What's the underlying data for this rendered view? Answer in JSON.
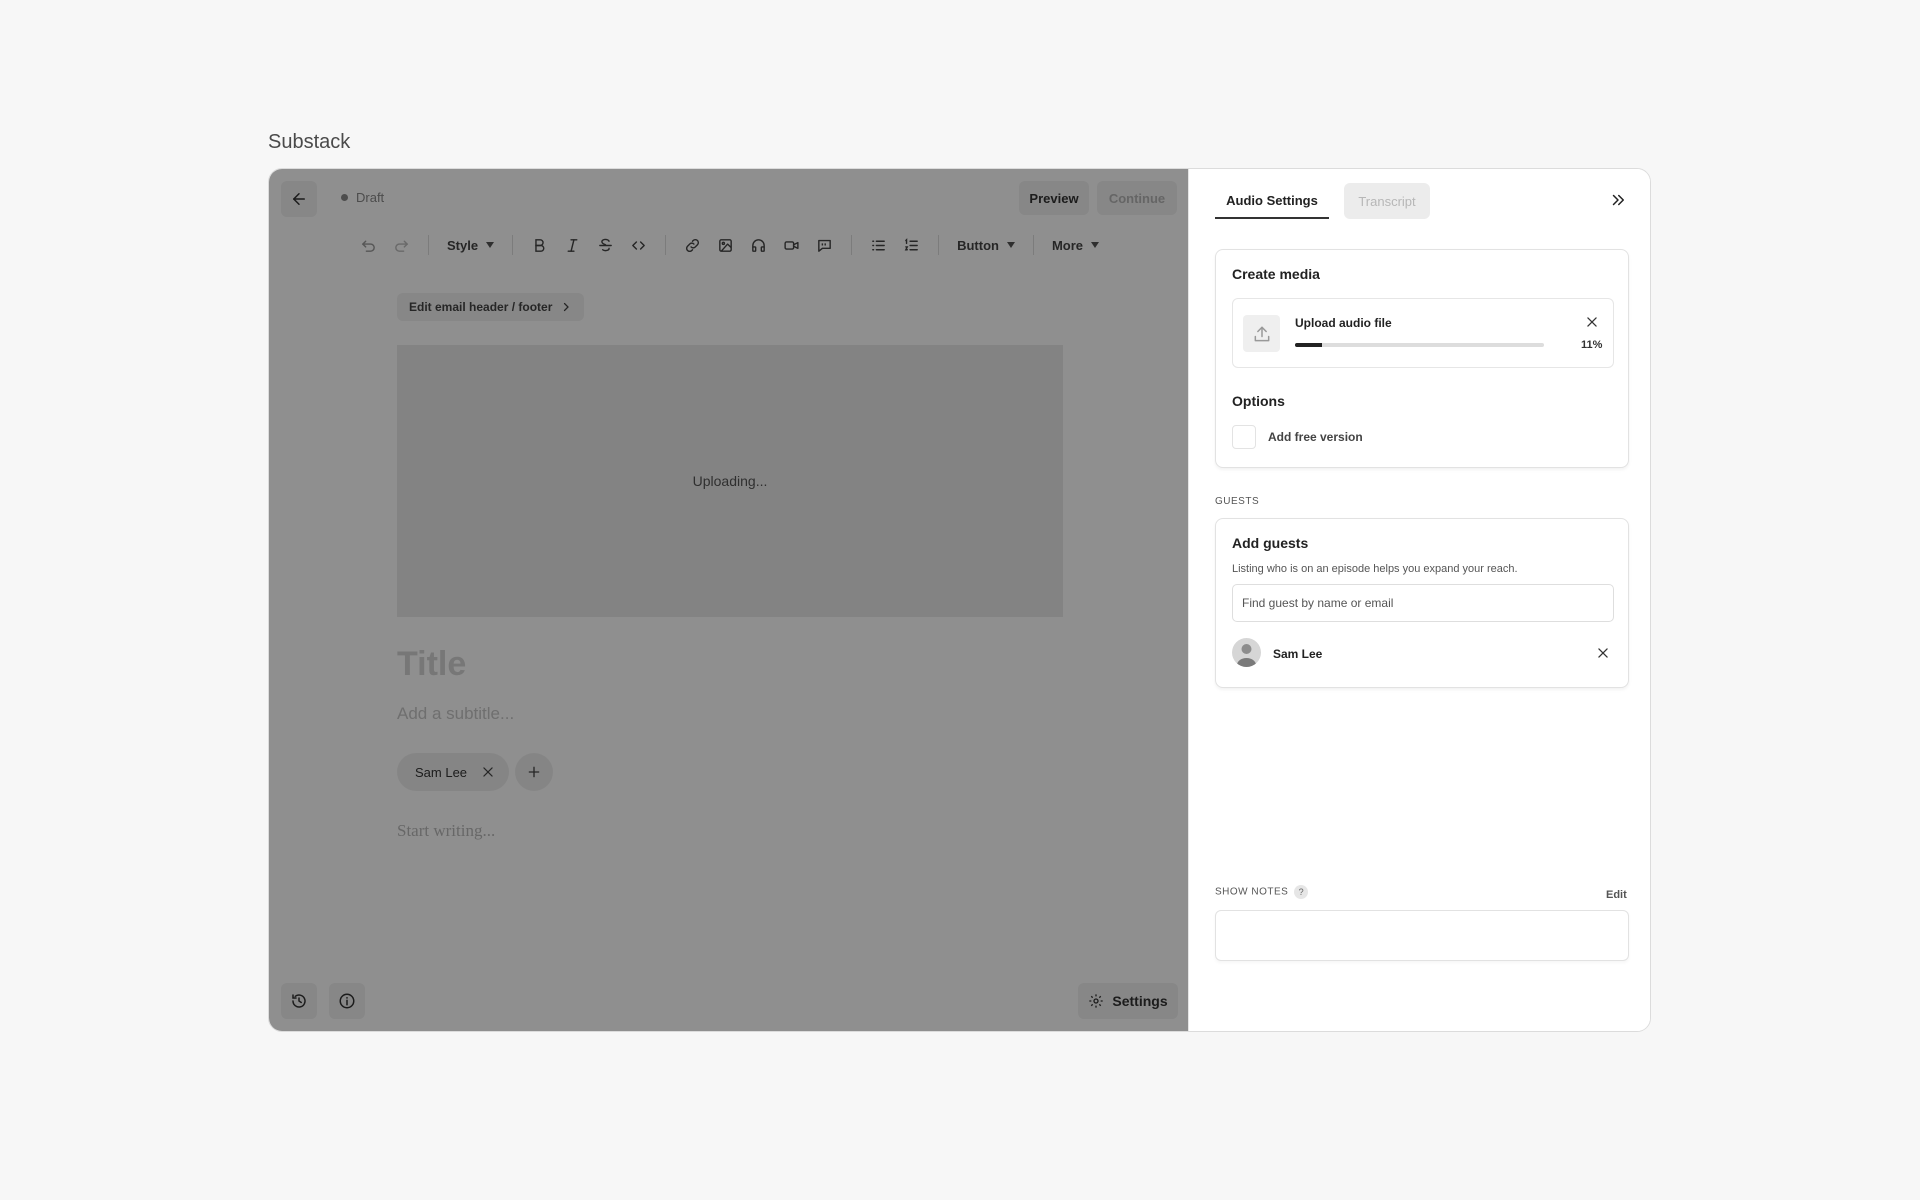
{
  "app": {
    "title": "Substack"
  },
  "editor": {
    "status": "Draft",
    "preview_label": "Preview",
    "continue_label": "Continue",
    "toolbar": {
      "style_label": "Style",
      "button_label": "Button",
      "more_label": "More"
    },
    "email_header_label": "Edit email header / footer",
    "upload_status": "Uploading...",
    "title_placeholder": "Title",
    "subtitle_placeholder": "Add a subtitle...",
    "author_chip": "Sam Lee",
    "body_placeholder": "Start writing...",
    "settings_label": "Settings"
  },
  "panel": {
    "tabs": [
      {
        "label": "Audio Settings",
        "active": true
      },
      {
        "label": "Transcript",
        "active": false
      }
    ],
    "create_media": {
      "title": "Create media",
      "upload_name": "Upload audio file",
      "progress_percent": 11,
      "progress_label": "11%"
    },
    "options": {
      "title": "Options",
      "free_version_label": "Add free version",
      "free_version_checked": false
    },
    "guests": {
      "section_label": "GUESTS",
      "title": "Add guests",
      "description": "Listing who is on an episode helps you expand your reach.",
      "search_placeholder": "Find guest by name or email",
      "list": [
        {
          "name": "Sam Lee"
        }
      ]
    },
    "show_notes": {
      "section_label": "SHOW NOTES",
      "help": "?",
      "edit_label": "Edit"
    }
  },
  "colors": {
    "accent": "#222222",
    "overlay": "#707070",
    "page_bg": "#f7f7f7"
  }
}
